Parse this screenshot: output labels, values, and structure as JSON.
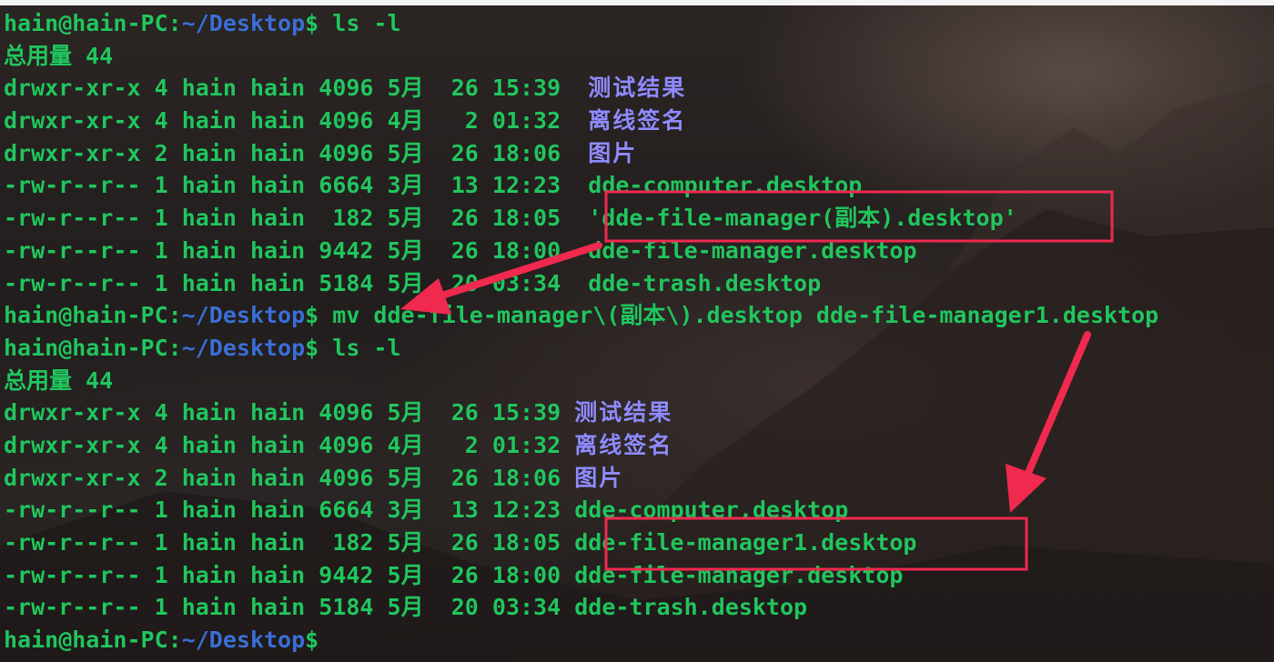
{
  "terminal": {
    "prompt": {
      "user_host": "hain@hain-PC",
      "colon": ":",
      "path": "~/Desktop",
      "dollar": "$"
    },
    "commands": {
      "first": "ls -l",
      "mv": "mv dde-file-manager\\(副本\\).desktop dde-file-manager1.desktop",
      "second": "ls -l",
      "last": ""
    },
    "listing1": {
      "total": "总用量 44",
      "entries": [
        {
          "perms": "drwxr-xr-x",
          "links": "4",
          "owner": "hain",
          "group": "hain",
          "size": "4096",
          "month": "5月",
          "day": "26",
          "time": "15:39",
          "name": "测试结果",
          "type": "dir"
        },
        {
          "perms": "drwxr-xr-x",
          "links": "4",
          "owner": "hain",
          "group": "hain",
          "size": "4096",
          "month": "4月",
          "day": "2",
          "time": "01:32",
          "name": "离线签名",
          "type": "dir"
        },
        {
          "perms": "drwxr-xr-x",
          "links": "2",
          "owner": "hain",
          "group": "hain",
          "size": "4096",
          "month": "5月",
          "day": "26",
          "time": "18:06",
          "name": "图片",
          "type": "dir"
        },
        {
          "perms": "-rw-r--r--",
          "links": "1",
          "owner": "hain",
          "group": "hain",
          "size": "6664",
          "month": "3月",
          "day": "13",
          "time": "12:23",
          "name": "dde-computer.desktop",
          "type": "file"
        },
        {
          "perms": "-rw-r--r--",
          "links": "1",
          "owner": "hain",
          "group": "hain",
          "size": "182",
          "month": "5月",
          "day": "26",
          "time": "18:05",
          "name": "'dde-file-manager(副本).desktop'",
          "type": "file"
        },
        {
          "perms": "-rw-r--r--",
          "links": "1",
          "owner": "hain",
          "group": "hain",
          "size": "9442",
          "month": "5月",
          "day": "26",
          "time": "18:00",
          "name": "dde-file-manager.desktop",
          "type": "file"
        },
        {
          "perms": "-rw-r--r--",
          "links": "1",
          "owner": "hain",
          "group": "hain",
          "size": "5184",
          "month": "5月",
          "day": "20",
          "time": "03:34",
          "name": "dde-trash.desktop",
          "type": "file"
        }
      ]
    },
    "listing2": {
      "total": "总用量 44",
      "entries": [
        {
          "perms": "drwxr-xr-x",
          "links": "4",
          "owner": "hain",
          "group": "hain",
          "size": "4096",
          "month": "5月",
          "day": "26",
          "time": "15:39",
          "name": "测试结果",
          "type": "dir"
        },
        {
          "perms": "drwxr-xr-x",
          "links": "4",
          "owner": "hain",
          "group": "hain",
          "size": "4096",
          "month": "4月",
          "day": "2",
          "time": "01:32",
          "name": "离线签名",
          "type": "dir"
        },
        {
          "perms": "drwxr-xr-x",
          "links": "2",
          "owner": "hain",
          "group": "hain",
          "size": "4096",
          "month": "5月",
          "day": "26",
          "time": "18:06",
          "name": "图片",
          "type": "dir"
        },
        {
          "perms": "-rw-r--r--",
          "links": "1",
          "owner": "hain",
          "group": "hain",
          "size": "6664",
          "month": "3月",
          "day": "13",
          "time": "12:23",
          "name": "dde-computer.desktop",
          "type": "file"
        },
        {
          "perms": "-rw-r--r--",
          "links": "1",
          "owner": "hain",
          "group": "hain",
          "size": "182",
          "month": "5月",
          "day": "26",
          "time": "18:05",
          "name": "dde-file-manager1.desktop",
          "type": "file"
        },
        {
          "perms": "-rw-r--r--",
          "links": "1",
          "owner": "hain",
          "group": "hain",
          "size": "9442",
          "month": "5月",
          "day": "26",
          "time": "18:00",
          "name": "dde-file-manager.desktop",
          "type": "file"
        },
        {
          "perms": "-rw-r--r--",
          "links": "1",
          "owner": "hain",
          "group": "hain",
          "size": "5184",
          "month": "5月",
          "day": "20",
          "time": "03:34",
          "name": "dde-trash.desktop",
          "type": "file"
        }
      ]
    },
    "colors": {
      "green": "#22c55e",
      "path_blue": "#3b6fd6",
      "dir_purple": "#8f8bff",
      "annotation_red": "#f0294f"
    }
  }
}
